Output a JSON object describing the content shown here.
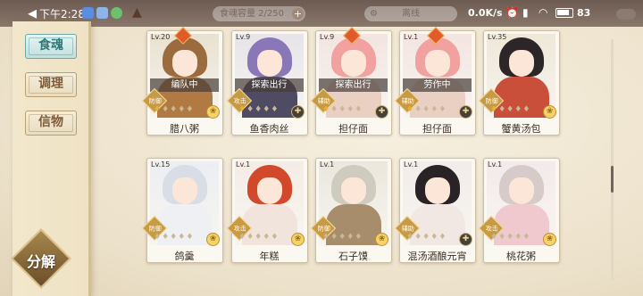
{
  "status_bar": {
    "time": "下午2:28",
    "capacity_text": "食魂容量 2/250",
    "capacity_plus": "+",
    "status_text": "离线",
    "network": "0.0K/s",
    "battery": "83"
  },
  "sidebar": {
    "tabs": [
      {
        "label": "食魂",
        "active": true
      },
      {
        "label": "调理",
        "active": false
      },
      {
        "label": "信物",
        "active": false
      }
    ],
    "decompose_label": "分解"
  },
  "cards": [
    {
      "level": "Lv.20",
      "name": "腊八粥",
      "status": "编队中",
      "role": "防御",
      "stars": 1,
      "elem": "gold",
      "hair": "#9a6b3e",
      "body": "#b27a43",
      "bg": "#e9e1cf",
      "gem": true
    },
    {
      "level": "Lv.9",
      "name": "鱼香肉丝",
      "status": "探索出行",
      "role": "攻击",
      "stars": 1,
      "elem": "dark",
      "hair": "#8a77b7",
      "body": "#4f4b63",
      "bg": "#e7e4ea",
      "gem": false
    },
    {
      "level": "Lv.9",
      "name": "担仔面",
      "status": "探索出行",
      "role": "辅助",
      "stars": 1,
      "elem": "dark",
      "hair": "#f1a2a0",
      "body": "#e9d0c3",
      "bg": "#f3e5e0",
      "gem": true
    },
    {
      "level": "Lv.1",
      "name": "担仔面",
      "status": "劳作中",
      "role": "辅助",
      "stars": 1,
      "elem": "dark",
      "hair": "#f1a2a0",
      "body": "#e9d0c3",
      "bg": "#f3e5e0",
      "gem": true
    },
    {
      "level": "Lv.35",
      "name": "蟹黄汤包",
      "status": "",
      "role": "防御",
      "stars": 1,
      "elem": "gold",
      "hair": "#2c2628",
      "body": "#c94f3b",
      "bg": "#efe7d8",
      "gem": false
    },
    {
      "level": "Lv.15",
      "name": "鸽羹",
      "status": "",
      "role": "防御",
      "stars": 0,
      "elem": "gold",
      "hair": "#d9dde6",
      "body": "#eef0f4",
      "bg": "#eceef2",
      "gem": false
    },
    {
      "level": "Lv.1",
      "name": "年糕",
      "status": "",
      "role": "攻击",
      "stars": 0,
      "elem": "gold",
      "hair": "#d2482b",
      "body": "#f1e4dc",
      "bg": "#f6ece6",
      "gem": false
    },
    {
      "level": "Lv.1",
      "name": "石子馍",
      "status": "",
      "role": "防御",
      "stars": 0,
      "elem": "gold",
      "hair": "#cfcbbf",
      "body": "#a78d6b",
      "bg": "#ebe7dd",
      "gem": false
    },
    {
      "level": "Lv.1",
      "name": "混汤酒酿元宵",
      "status": "",
      "role": "辅助",
      "stars": 0,
      "elem": "dark",
      "hair": "#2a2326",
      "body": "#f1e7e3",
      "bg": "#f2ecea",
      "gem": false
    },
    {
      "level": "Lv.1",
      "name": "桃花粥",
      "status": "",
      "role": "攻击",
      "stars": 0,
      "elem": "gold",
      "hair": "#d7cbc9",
      "body": "#f0c9cf",
      "bg": "#f4eaeb",
      "gem": false
    }
  ]
}
